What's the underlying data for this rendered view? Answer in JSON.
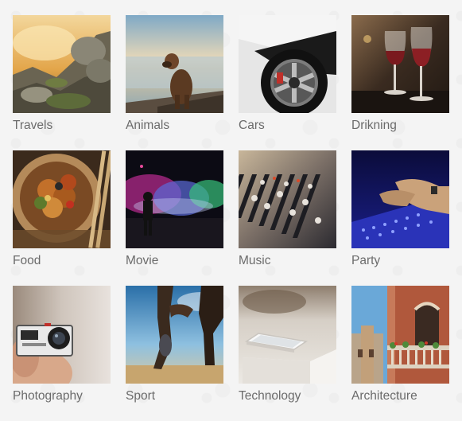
{
  "gallery": {
    "items": [
      {
        "label": "Travels",
        "icon": "travels-photo"
      },
      {
        "label": "Animals",
        "icon": "animals-photo"
      },
      {
        "label": "Cars",
        "icon": "cars-photo"
      },
      {
        "label": "Drikning",
        "icon": "drinking-photo"
      },
      {
        "label": "Food",
        "icon": "food-photo"
      },
      {
        "label": "Movie",
        "icon": "movie-photo"
      },
      {
        "label": "Music",
        "icon": "music-photo"
      },
      {
        "label": "Party",
        "icon": "party-photo"
      },
      {
        "label": "Photography",
        "icon": "photography-photo"
      },
      {
        "label": "Sport",
        "icon": "sport-photo"
      },
      {
        "label": "Technology",
        "icon": "technology-photo"
      },
      {
        "label": "Architecture",
        "icon": "architecture-photo"
      }
    ]
  }
}
